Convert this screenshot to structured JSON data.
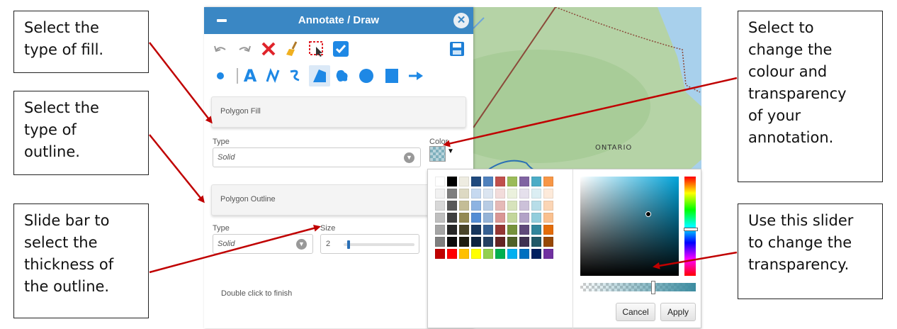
{
  "panel": {
    "title": "Annotate / Draw",
    "fill_section": "Polygon Fill",
    "fill_type_label": "Type",
    "fill_type_value": "Solid",
    "color_label": "Color",
    "outline_section": "Polygon Outline",
    "outline_type_label": "Type",
    "outline_type_value": "Solid",
    "size_label": "Size",
    "size_value": "2",
    "size_fraction": 0.05,
    "hint": "Double click to finish"
  },
  "map": {
    "place_label": "ONTARIO"
  },
  "picker": {
    "cancel_label": "Cancel",
    "apply_label": "Apply",
    "palette": [
      "#ffffff",
      "#000000",
      "#eeece1",
      "#1f497d",
      "#4f81bd",
      "#c0504d",
      "#9bbb59",
      "#8064a2",
      "#4bacc6",
      "#f79646",
      "#f2f2f2",
      "#7f7f7f",
      "#ddd9c3",
      "#c6d9f0",
      "#dbe5f1",
      "#f2dcdb",
      "#ebf1dd",
      "#e5e0ec",
      "#dbeef3",
      "#fdeada",
      "#d8d8d8",
      "#595959",
      "#c4bd97",
      "#8db3e2",
      "#b8cce4",
      "#e5b9b7",
      "#d7e3bc",
      "#ccc1d9",
      "#b7dde8",
      "#fbd5b5",
      "#bfbfbf",
      "#3f3f3f",
      "#938953",
      "#548dd4",
      "#95b3d7",
      "#d99694",
      "#c3d69b",
      "#b2a2c7",
      "#92cddc",
      "#fac08f",
      "#a5a5a5",
      "#262626",
      "#494429",
      "#17365d",
      "#366092",
      "#953734",
      "#76923c",
      "#5f497a",
      "#31859b",
      "#e36c09",
      "#7f7f7f",
      "#0c0c0c",
      "#1d1b10",
      "#0f243e",
      "#244061",
      "#632423",
      "#4f6128",
      "#3f3151",
      "#205867",
      "#974806",
      "#c00000",
      "#ff0000",
      "#ffc000",
      "#ffff00",
      "#92d050",
      "#00b050",
      "#00b0f0",
      "#0070c0",
      "#002060",
      "#7030a0"
    ]
  },
  "callouts": {
    "fill": "Select the\ntype of fill.",
    "outline": "Select the\ntype of\noutline.",
    "thickness": "Slide bar to\nselect the\nthickness of\nthe outline.",
    "colour": "Select to\nchange the\ncolour and\ntransparency\nof your\nannotation.",
    "transparency": "Use this slider\nto change the\ntransparency."
  }
}
